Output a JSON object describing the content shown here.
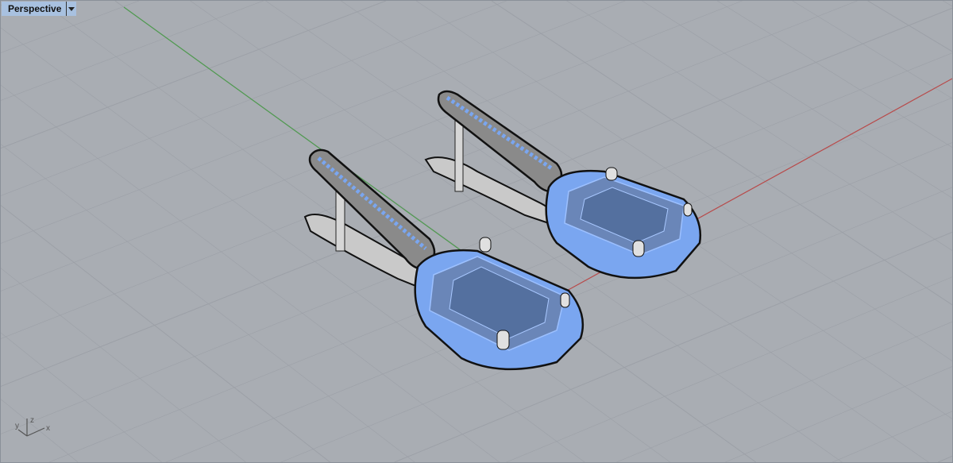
{
  "viewport": {
    "name": "Perspective",
    "menu_icon": "dropdown-triangle-icon",
    "axis_labels": {
      "x": "x",
      "y": "y",
      "z": "z"
    }
  },
  "colors": {
    "background": "#a9adb3",
    "grid": "#9ca0a7",
    "x_axis": "#b84a4a",
    "y_axis": "#4f9a4f",
    "selection": "#7aa6f0",
    "tab": "#a8c1e0"
  }
}
